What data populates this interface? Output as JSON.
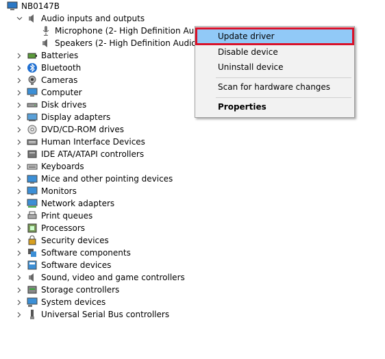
{
  "root": {
    "label": "NB0147B"
  },
  "audio": {
    "label": "Audio inputs and outputs",
    "children": [
      "Microphone (2- High Definition Audio Device)",
      "Speakers (2- High Definition Audio Device)"
    ]
  },
  "categories": [
    {
      "label": "Batteries",
      "icon": "battery-icon"
    },
    {
      "label": "Bluetooth",
      "icon": "bluetooth-icon"
    },
    {
      "label": "Cameras",
      "icon": "camera-icon"
    },
    {
      "label": "Computer",
      "icon": "computer-icon"
    },
    {
      "label": "Disk drives",
      "icon": "disk-drive-icon"
    },
    {
      "label": "Display adapters",
      "icon": "display-adapter-icon"
    },
    {
      "label": "DVD/CD-ROM drives",
      "icon": "dvd-drive-icon"
    },
    {
      "label": "Human Interface Devices",
      "icon": "hid-icon"
    },
    {
      "label": "IDE ATA/ATAPI controllers",
      "icon": "ide-controller-icon"
    },
    {
      "label": "Keyboards",
      "icon": "keyboard-icon"
    },
    {
      "label": "Mice and other pointing devices",
      "icon": "mouse-icon"
    },
    {
      "label": "Monitors",
      "icon": "monitor-icon"
    },
    {
      "label": "Network adapters",
      "icon": "network-adapter-icon"
    },
    {
      "label": "Print queues",
      "icon": "printer-icon"
    },
    {
      "label": "Processors",
      "icon": "processor-icon"
    },
    {
      "label": "Security devices",
      "icon": "security-device-icon"
    },
    {
      "label": "Software components",
      "icon": "software-component-icon"
    },
    {
      "label": "Software devices",
      "icon": "software-device-icon"
    },
    {
      "label": "Sound, video and game controllers",
      "icon": "sound-controller-icon"
    },
    {
      "label": "Storage controllers",
      "icon": "storage-controller-icon"
    },
    {
      "label": "System devices",
      "icon": "system-device-icon"
    },
    {
      "label": "Universal Serial Bus controllers",
      "icon": "usb-icon"
    }
  ],
  "context_menu": {
    "update_driver": "Update driver",
    "disable_device": "Disable device",
    "uninstall_device": "Uninstall device",
    "scan": "Scan for hardware changes",
    "properties": "Properties"
  },
  "colors": {
    "highlight": "#91c9f7",
    "annotation_border": "#d9122a",
    "menu_bg": "#f2f2f2"
  }
}
